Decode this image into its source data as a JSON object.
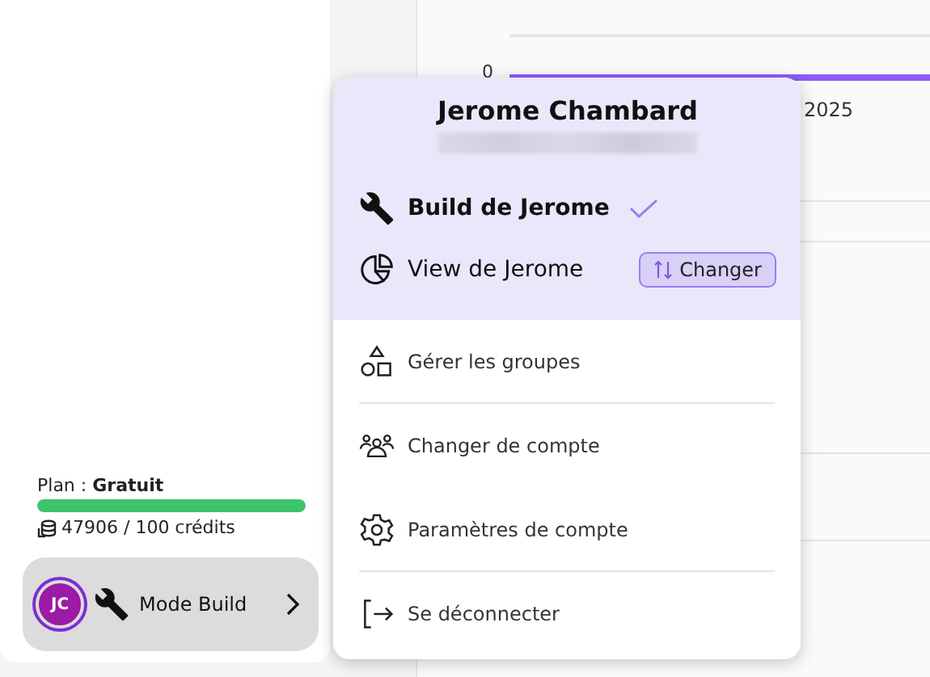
{
  "chart": {
    "y_tick": "0",
    "x_label": "2025"
  },
  "sidebar": {
    "plan_label": "Plan : ",
    "plan_name": "Gratuit",
    "level": 1,
    "credits": "47906 / 100 crédits",
    "mode_button": {
      "initials": "JC",
      "label": "Mode Build"
    }
  },
  "account_menu": {
    "name": "Jerome Chambard",
    "workspaces": [
      {
        "kind": "build",
        "label": "Build de Jerome",
        "selected": true
      },
      {
        "kind": "view",
        "label": "View de Jerome",
        "selected": false,
        "action": "Changer"
      }
    ],
    "items": [
      {
        "kind": "groups",
        "label": "Gérer les groupes"
      },
      {
        "kind": "account",
        "label": "Changer de compte"
      },
      {
        "kind": "settings",
        "label": "Paramètres de compte"
      },
      {
        "kind": "logout",
        "label": "Se déconnecter"
      }
    ]
  }
}
